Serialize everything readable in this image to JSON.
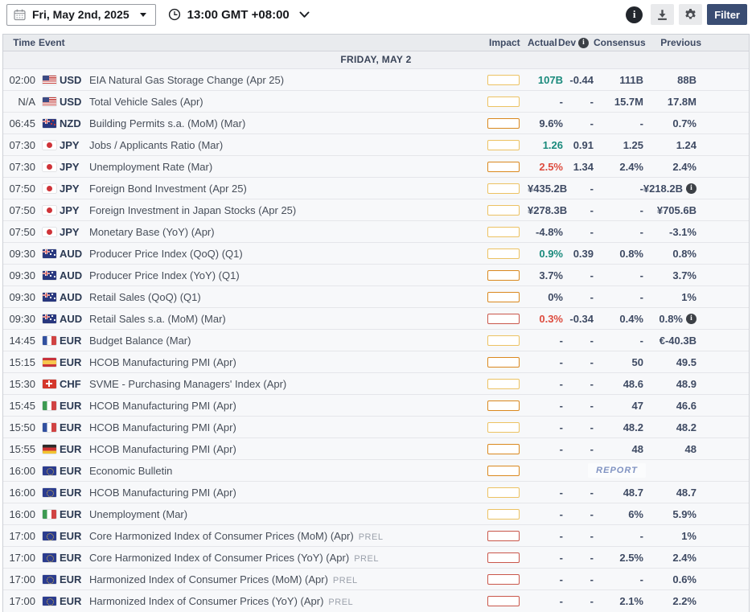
{
  "toolbar": {
    "date_label": "Fri, May 2nd, 2025",
    "time_label": "13:00 GMT +08:00",
    "filter_label": "Filter",
    "info_glyph": "i"
  },
  "icons": {
    "calendar": "calendar-grid",
    "clock": "clock-face",
    "caret": "▼",
    "chevron": "⌄",
    "download": "⭳",
    "gear": "⚙",
    "info": "i"
  },
  "colors": {
    "value_teal": "#1a8a7c",
    "value_red": "#dd4b3e",
    "value_navy": "#3e4a63",
    "impact_low": "#ecc262",
    "impact_medium": "#dd8a1e",
    "impact_high": "#cd5a4c",
    "filter_button": "#3a4d73"
  },
  "table": {
    "headers": {
      "time": "Time",
      "event": "Event",
      "impact": "Impact",
      "actual": "Actual",
      "dev": "Dev",
      "consensus": "Consensus",
      "previous": "Previous"
    },
    "date_band": "FRIDAY, MAY 2",
    "rows": [
      {
        "time": "02:00",
        "flag": "us",
        "currency": "USD",
        "event": "EIA Natural Gas Storage Change (Apr 25)",
        "impact": "low",
        "actual": "107B",
        "actual_tone": "better",
        "dev": "-0.44",
        "consensus": "111B",
        "previous": "88B"
      },
      {
        "time": "N/A",
        "flag": "us",
        "currency": "USD",
        "event": "Total Vehicle Sales (Apr)",
        "impact": "low",
        "actual": "-",
        "dev": "-",
        "consensus": "15.7M",
        "previous": "17.8M"
      },
      {
        "time": "06:45",
        "flag": "nz",
        "currency": "NZD",
        "event": "Building Permits s.a. (MoM) (Mar)",
        "impact": "medium",
        "actual": "9.6%",
        "dev": "-",
        "consensus": "-",
        "previous": "0.7%"
      },
      {
        "time": "07:30",
        "flag": "jp",
        "currency": "JPY",
        "event": "Jobs / Applicants Ratio (Mar)",
        "impact": "low",
        "actual": "1.26",
        "actual_tone": "better",
        "dev": "0.91",
        "consensus": "1.25",
        "previous": "1.24"
      },
      {
        "time": "07:30",
        "flag": "jp",
        "currency": "JPY",
        "event": "Unemployment Rate (Mar)",
        "impact": "medium",
        "actual": "2.5%",
        "actual_tone": "worse",
        "dev": "1.34",
        "consensus": "2.4%",
        "previous": "2.4%"
      },
      {
        "time": "07:50",
        "flag": "jp",
        "currency": "JPY",
        "event": "Foreign Bond Investment (Apr 25)",
        "impact": "low",
        "actual": "¥435.2B",
        "dev": "-",
        "consensus": "-",
        "previous": "¥218.2B",
        "previous_icon": true
      },
      {
        "time": "07:50",
        "flag": "jp",
        "currency": "JPY",
        "event": "Foreign Investment in Japan Stocks (Apr 25)",
        "impact": "low",
        "actual": "¥278.3B",
        "dev": "-",
        "consensus": "-",
        "previous": "¥705.6B"
      },
      {
        "time": "07:50",
        "flag": "jp",
        "currency": "JPY",
        "event": "Monetary Base (YoY) (Apr)",
        "impact": "low",
        "actual": "-4.8%",
        "dev": "-",
        "consensus": "-",
        "previous": "-3.1%"
      },
      {
        "time": "09:30",
        "flag": "au",
        "currency": "AUD",
        "event": "Producer Price Index (QoQ) (Q1)",
        "impact": "low",
        "actual": "0.9%",
        "actual_tone": "better",
        "dev": "0.39",
        "consensus": "0.8%",
        "previous": "0.8%"
      },
      {
        "time": "09:30",
        "flag": "au",
        "currency": "AUD",
        "event": "Producer Price Index (YoY) (Q1)",
        "impact": "medium",
        "actual": "3.7%",
        "dev": "-",
        "consensus": "-",
        "previous": "3.7%"
      },
      {
        "time": "09:30",
        "flag": "au",
        "currency": "AUD",
        "event": "Retail Sales (QoQ) (Q1)",
        "impact": "medium",
        "actual": "0%",
        "dev": "-",
        "consensus": "-",
        "previous": "1%"
      },
      {
        "time": "09:30",
        "flag": "au",
        "currency": "AUD",
        "event": "Retail Sales s.a. (MoM) (Mar)",
        "impact": "high",
        "actual": "0.3%",
        "actual_tone": "worse",
        "dev": "-0.34",
        "consensus": "0.4%",
        "previous": "0.8%",
        "previous_icon": true
      },
      {
        "time": "14:45",
        "flag": "fr",
        "currency": "EUR",
        "event": "Budget Balance (Mar)",
        "impact": "low",
        "actual": "-",
        "dev": "-",
        "consensus": "-",
        "previous": "€-40.3B"
      },
      {
        "time": "15:15",
        "flag": "es",
        "currency": "EUR",
        "event": "HCOB Manufacturing PMI (Apr)",
        "impact": "medium",
        "actual": "-",
        "dev": "-",
        "consensus": "50",
        "previous": "49.5"
      },
      {
        "time": "15:30",
        "flag": "ch",
        "currency": "CHF",
        "event": "SVME - Purchasing Managers' Index (Apr)",
        "impact": "low",
        "actual": "-",
        "dev": "-",
        "consensus": "48.6",
        "previous": "48.9"
      },
      {
        "time": "15:45",
        "flag": "it",
        "currency": "EUR",
        "event": "HCOB Manufacturing PMI (Apr)",
        "impact": "medium",
        "actual": "-",
        "dev": "-",
        "consensus": "47",
        "previous": "46.6"
      },
      {
        "time": "15:50",
        "flag": "fr",
        "currency": "EUR",
        "event": "HCOB Manufacturing PMI (Apr)",
        "impact": "low",
        "actual": "-",
        "dev": "-",
        "consensus": "48.2",
        "previous": "48.2"
      },
      {
        "time": "15:55",
        "flag": "de",
        "currency": "EUR",
        "event": "HCOB Manufacturing PMI (Apr)",
        "impact": "medium",
        "actual": "-",
        "dev": "-",
        "consensus": "48",
        "previous": "48"
      },
      {
        "time": "16:00",
        "flag": "eu",
        "currency": "EUR",
        "event": "Economic Bulletin",
        "impact": "medium",
        "report": "REPORT"
      },
      {
        "time": "16:00",
        "flag": "eu",
        "currency": "EUR",
        "event": "HCOB Manufacturing PMI (Apr)",
        "impact": "low",
        "actual": "-",
        "dev": "-",
        "consensus": "48.7",
        "previous": "48.7"
      },
      {
        "time": "16:00",
        "flag": "it",
        "currency": "EUR",
        "event": "Unemployment (Mar)",
        "impact": "low",
        "actual": "-",
        "dev": "-",
        "consensus": "6%",
        "previous": "5.9%"
      },
      {
        "time": "17:00",
        "flag": "eu",
        "currency": "EUR",
        "event": "Core Harmonized Index of Consumer Prices (MoM) (Apr)",
        "suffix": "PREL",
        "impact": "high",
        "actual": "-",
        "dev": "-",
        "consensus": "-",
        "previous": "1%"
      },
      {
        "time": "17:00",
        "flag": "eu",
        "currency": "EUR",
        "event": "Core Harmonized Index of Consumer Prices (YoY) (Apr)",
        "suffix": "PREL",
        "impact": "high",
        "actual": "-",
        "dev": "-",
        "consensus": "2.5%",
        "previous": "2.4%"
      },
      {
        "time": "17:00",
        "flag": "eu",
        "currency": "EUR",
        "event": "Harmonized Index of Consumer Prices (MoM) (Apr)",
        "suffix": "PREL",
        "impact": "high",
        "actual": "-",
        "dev": "-",
        "consensus": "-",
        "previous": "0.6%"
      },
      {
        "time": "17:00",
        "flag": "eu",
        "currency": "EUR",
        "event": "Harmonized Index of Consumer Prices (YoY) (Apr)",
        "suffix": "PREL",
        "impact": "high",
        "actual": "-",
        "dev": "-",
        "consensus": "2.1%",
        "previous": "2.2%"
      }
    ]
  }
}
